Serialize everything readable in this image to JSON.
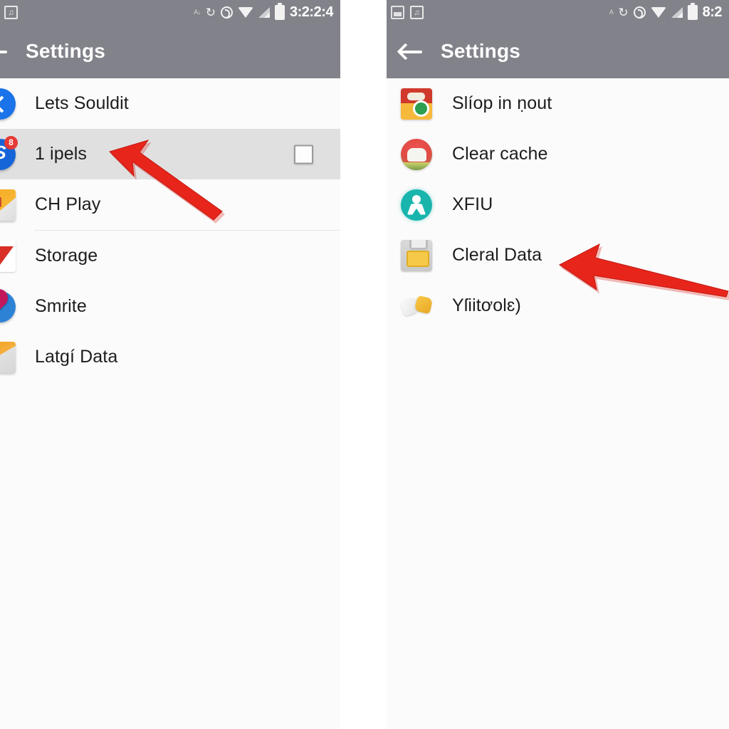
{
  "left_panel": {
    "status_bar": {
      "clock": "3:2:2:4",
      "icons_left": [
        "note-icon"
      ],
      "icons_right": [
        "alarm-icon",
        "sync-icon",
        "record-icon",
        "wifi-icon",
        "signal-icon",
        "battery-icon"
      ]
    },
    "app_bar": {
      "title": "Settings",
      "back_icon": "back-arrow-icon"
    },
    "list": [
      {
        "label": "Lets Souldit",
        "icon": "blue-chevron-app-icon",
        "selected": false,
        "checkbox": false,
        "divider_after": false
      },
      {
        "label": "1 ipels",
        "icon": "blue-s-badge-app-icon",
        "selected": true,
        "checkbox": true,
        "divider_after": false
      },
      {
        "label": "CH Play",
        "icon": "orange-document-app-icon",
        "selected": false,
        "checkbox": false,
        "divider_after": true
      },
      {
        "label": "Storage",
        "icon": "red-envelope-app-icon",
        "selected": false,
        "checkbox": false,
        "divider_after": false
      },
      {
        "label": "Smrite",
        "icon": "blue-map-pin-app-icon",
        "selected": false,
        "checkbox": false,
        "divider_after": false
      },
      {
        "label": "Latɡí Data",
        "icon": "orange-key-doc-app-icon",
        "selected": false,
        "checkbox": false,
        "divider_after": false
      }
    ]
  },
  "right_panel": {
    "status_bar": {
      "clock": "8:2",
      "icons_left": [
        "minimize-icon",
        "note-icon"
      ],
      "icons_right": [
        "alarm-icon",
        "sync-icon",
        "record-icon",
        "wifi-icon",
        "signal-icon",
        "battery-icon"
      ]
    },
    "app_bar": {
      "title": "Settings",
      "back_icon": "back-arrow-icon"
    },
    "list": [
      {
        "label": "Slíop in ṇout",
        "icon": "red-yellow-square-app-icon",
        "selected": false,
        "checkbox": false,
        "divider_after": false
      },
      {
        "label": "Clear cache",
        "icon": "red-white-cache-app-icon",
        "selected": false,
        "checkbox": false,
        "divider_after": false
      },
      {
        "label": "XFIU",
        "icon": "teal-figure-app-icon",
        "selected": false,
        "checkbox": false,
        "divider_after": false
      },
      {
        "label": "Cleral Data",
        "icon": "gray-yellow-briefcase-icon",
        "selected": false,
        "checkbox": false,
        "divider_after": false
      },
      {
        "label": "Yſiitơolɛ)",
        "icon": "yellow-white-hands-icon",
        "selected": false,
        "checkbox": false,
        "divider_after": false
      }
    ]
  },
  "annotations": [
    {
      "name": "left-arrow-pointer",
      "color": "#E8251B",
      "points_at": "1 ipels"
    },
    {
      "name": "right-arrow-pointer",
      "color": "#E8251B",
      "points_at": "Cleral Data"
    }
  ],
  "colors": {
    "app_bar": "#82838A",
    "panel_bg": "#FBFBFB",
    "selected_row": "#E0E0E0",
    "text": "#1D1D1D",
    "arrow": "#E8251B"
  }
}
